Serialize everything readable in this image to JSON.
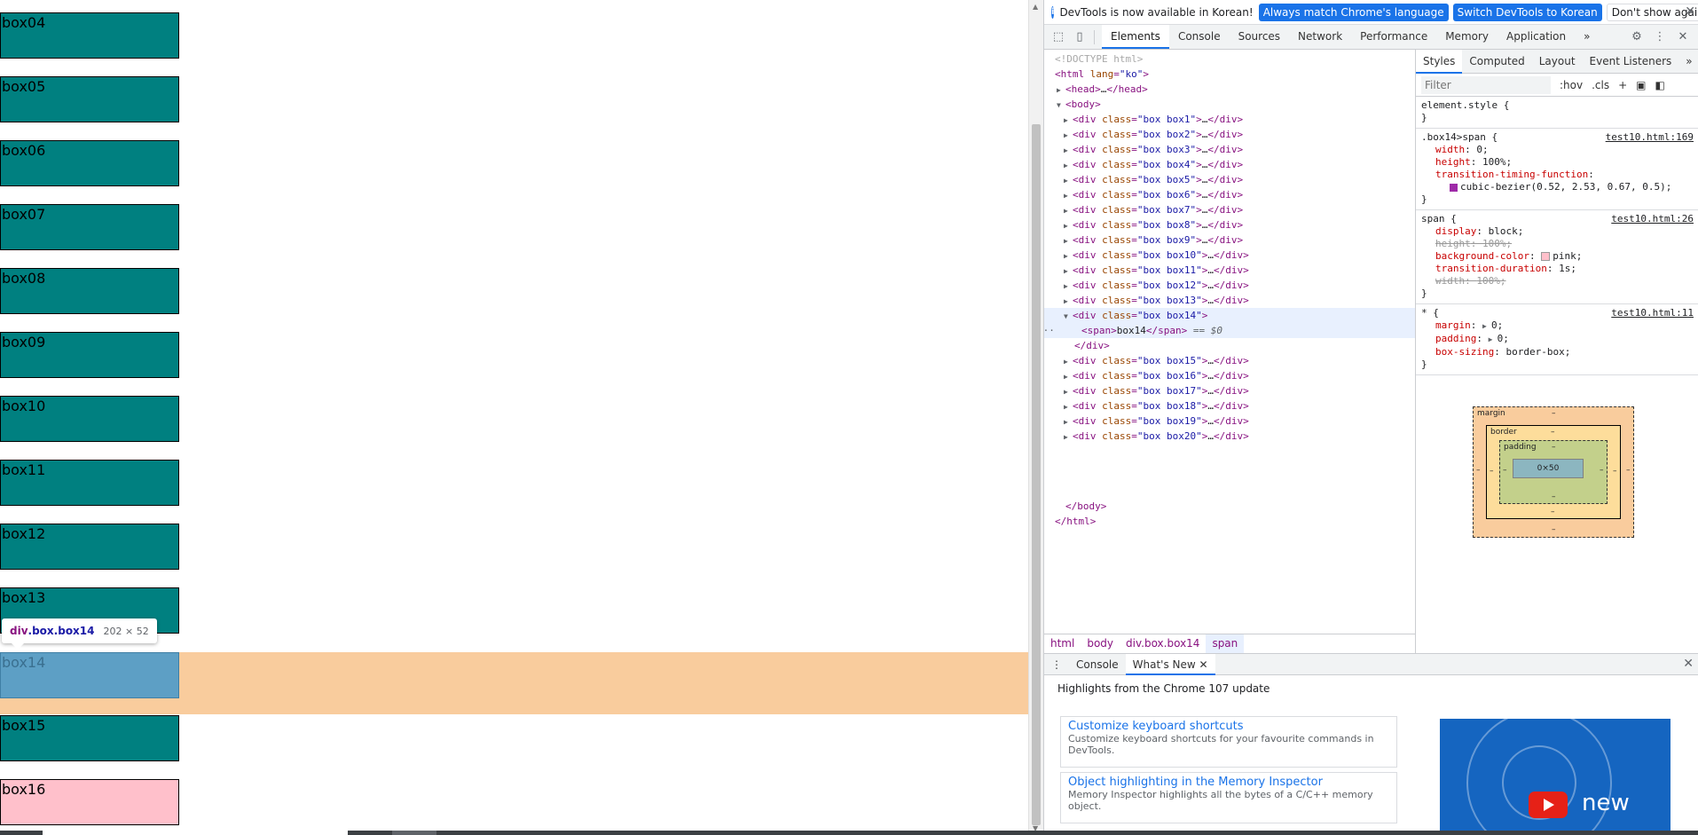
{
  "page": {
    "boxes": [
      {
        "label": "box04"
      },
      {
        "label": "box05"
      },
      {
        "label": "box06"
      },
      {
        "label": "box07"
      },
      {
        "label": "box08"
      },
      {
        "label": "box09"
      },
      {
        "label": "box10"
      },
      {
        "label": "box11"
      },
      {
        "label": "box12"
      },
      {
        "label": "box13"
      }
    ],
    "highlighted_box": "box14",
    "boxes_after": [
      {
        "label": "box15"
      },
      {
        "label": "box16"
      }
    ],
    "tooltip": {
      "tag": "div",
      "classes": ".box.box14",
      "size": "202 × 52"
    },
    "colors": {
      "teal": "#008080",
      "pink": "#ffc0cb",
      "margin_highlight": "#f9cc9d",
      "content_highlight": "#5d9fc5"
    }
  },
  "devtools": {
    "infobar": {
      "message": "DevTools is now available in Korean!",
      "btn_match": "Always match Chrome's language",
      "btn_switch": "Switch DevTools to Korean",
      "btn_dismiss": "Don't show again"
    },
    "tabs": [
      "Elements",
      "Console",
      "Sources",
      "Network",
      "Performance",
      "Memory",
      "Application"
    ],
    "active_tab": "Elements",
    "dom": {
      "doctype": "<!DOCTYPE html>",
      "html_open": "html",
      "lang_attr": "lang",
      "lang_val": "\"ko\"",
      "head": "head",
      "body": "body",
      "collapsed_divs": [
        "box1",
        "box2",
        "box3",
        "box4",
        "box5",
        "box6",
        "box7",
        "box8",
        "box9",
        "box10",
        "box11",
        "box12",
        "box13"
      ],
      "expanded_div": "box14",
      "span_text": "box14",
      "selected_marker": "== $0",
      "collapsed_divs_after": [
        "box15",
        "box16",
        "box17",
        "box18",
        "box19",
        "box20"
      ]
    },
    "breadcrumb": [
      "html",
      "body",
      "div.box.box14",
      "span"
    ],
    "styles": {
      "tabs": [
        "Styles",
        "Computed",
        "Layout",
        "Event Listeners"
      ],
      "filter_placeholder": "Filter",
      "hov": ":hov",
      "cls": ".cls",
      "element_style": "element.style {",
      "rule1": {
        "selector": ".box14>span {",
        "source": "test10.html:169",
        "decls": [
          {
            "p": "width",
            "v": "0;"
          },
          {
            "p": "height",
            "v": "100%;"
          },
          {
            "p": "transition-timing-function",
            "v": ""
          },
          {
            "p": "",
            "v": "cubic-bezier(0.52, 2.53, 0.67, 0.5);"
          }
        ]
      },
      "rule2": {
        "selector": "span {",
        "source": "test10.html:26",
        "decls": [
          {
            "p": "display",
            "v": "block;",
            "strike": false
          },
          {
            "p": "height",
            "v": "100%;",
            "strike": true
          },
          {
            "p": "background-color",
            "v": "pink;",
            "strike": false
          },
          {
            "p": "transition-duration",
            "v": "1s;",
            "strike": false
          },
          {
            "p": "width",
            "v": "100%;",
            "strike": true
          }
        ]
      },
      "rule3": {
        "selector": "* {",
        "source": "test10.html:11",
        "decls": [
          {
            "p": "margin",
            "v": "0;"
          },
          {
            "p": "padding",
            "v": "0;"
          },
          {
            "p": "box-sizing",
            "v": "border-box;"
          }
        ]
      },
      "boxmodel": {
        "margin": "margin",
        "border": "border",
        "padding": "padding",
        "content": "0×50",
        "dash": "–"
      }
    },
    "drawer": {
      "tabs": [
        "Console",
        "What's New"
      ],
      "active_tab": "What's New",
      "title": "Highlights from the Chrome 107 update",
      "cards": [
        {
          "title": "Customize keyboard shortcuts",
          "desc": "Customize keyboard shortcuts for your favourite commands in DevTools."
        },
        {
          "title": "Object highlighting in the Memory Inspector",
          "desc": "Memory Inspector highlights all the bytes of a C/C++ memory object."
        }
      ],
      "video_text": "new"
    }
  }
}
